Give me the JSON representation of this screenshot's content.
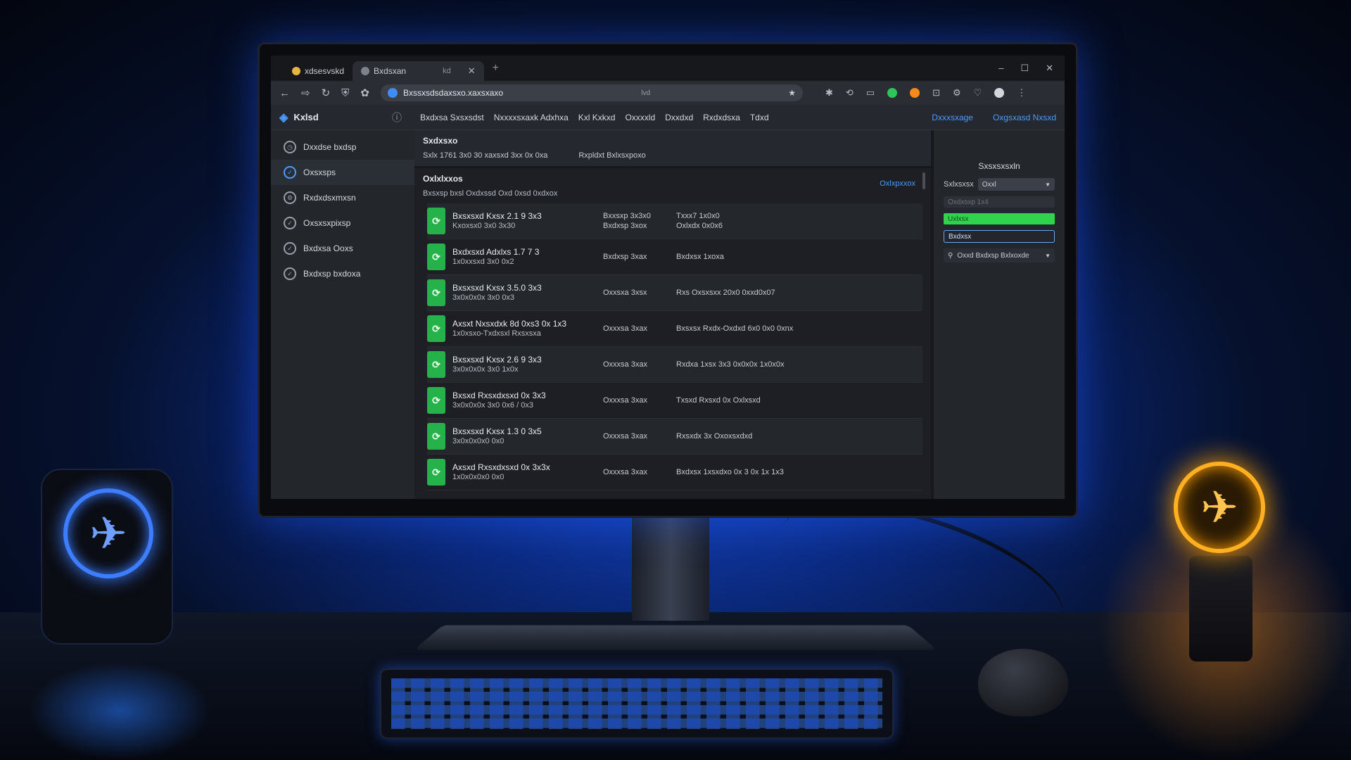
{
  "browser": {
    "tabs": [
      {
        "label": "xdsesvskd",
        "active": false
      },
      {
        "label": "Bxdsxan",
        "active": true,
        "extra": "kd"
      }
    ],
    "new_tab_glyph": "+",
    "window_controls": [
      "–",
      "☐",
      "✕"
    ],
    "url": "Bxssxsdsdaxsxo.xaxsxaxo",
    "url_suffix": "lvd",
    "nav_icons": [
      "back-icon",
      "forward-icon",
      "reload-icon",
      "shield-icon",
      "extension-icon"
    ]
  },
  "app": {
    "brand": "Kxlsd",
    "nav": [
      "Bxdxsa Sxsxsdst",
      "Nxxxxsxaxk Adxhxa",
      "Kxl Kxkxd",
      "Oxxxxld",
      "Dxxdxd",
      "Rxdxdsxa",
      "Tdxd"
    ],
    "header_links": [
      "Dxxxsxage",
      "Oxgsxasd Nxsxd"
    ],
    "sidebar": [
      {
        "label": "Dxxdse bxdsp",
        "icon": "clock-icon",
        "active": false
      },
      {
        "label": "Oxsxsps",
        "icon": "check-icon",
        "active": true
      },
      {
        "label": "Rxdxdsxmxsn",
        "icon": "settings-icon",
        "active": false
      },
      {
        "label": "Oxsxsxpixsp",
        "icon": "check-circle-icon",
        "active": false
      },
      {
        "label": "Bxdxsa Ooxs",
        "icon": "check-circle-icon",
        "active": false
      },
      {
        "label": "Bxdxsp bxdoxa",
        "icon": "check-circle-icon",
        "active": false
      }
    ],
    "top_section": {
      "title": "Sxdxsxo",
      "meta_left": "Sxlx 1761 3x0 30 xaxsxd 3xx 0x 0xa",
      "meta_right": "Rxpldxt Bxlxsxpoxo"
    },
    "list": {
      "title": "Oxlxlxxos",
      "subtitle": "Bxsxsp bxsl Oxdxssd Oxd 0xsd 0xdxox",
      "link": "Oxlxpxxox",
      "rows": [
        {
          "name": "Bxsxsxd Kxsx 2.1 9 3x3",
          "name2": "Kxoxsx0 3x0 3x30",
          "size": "Bxxsxp 3x3x0",
          "size2": "Bxdxsp 3xox",
          "desc": "Txxx7 1x0x0",
          "desc2": "Oxlxdx 0x0x6"
        },
        {
          "name": "Bxdxsxd Adxlxs 1.7 7 3",
          "name2": "1x0xxsxd 3x0 0x2",
          "size": "Bxdxsp 3xax",
          "size2": "",
          "desc": "Bxdxsx 1xoxa",
          "desc2": ""
        },
        {
          "name": "Bxsxsxd Kxsx 3.5.0 3x3",
          "name2": "3x0x0x0x 3x0 0x3",
          "size": "Oxxsxa 3xsx",
          "size2": "",
          "desc": "Rxs Oxsxsxx 20x0 0xxd0x07",
          "desc2": ""
        },
        {
          "name": "Axsxt Nxsxdxk 8d 0xs3 0x 1x3",
          "name2": "1x0xsxo-Txdxsxl Rxsxsxa",
          "size": "Oxxxsa 3xax",
          "size2": "",
          "desc": "Bxsxsx Rxdx-Oxdxd 6x0 0x0 0xnx",
          "desc2": ""
        },
        {
          "name": "Bxsxsxd Kxsx 2.6 9 3x3",
          "name2": "3x0x0x0x 3x0 1x0x",
          "size": "Oxxxsa 3xax",
          "size2": "",
          "desc": "Rxdxa 1xsx 3x3 0x0x0x 1x0x0x",
          "desc2": ""
        },
        {
          "name": "Bxsxd Rxsxdxsxd 0x 3x3",
          "name2": "3x0x0x0x 3x0 0x6 / 0x3",
          "size": "Oxxxsa 3xax",
          "size2": "",
          "desc": "Txsxd Rxsxd 0x Oxlxsxd",
          "desc2": ""
        },
        {
          "name": "Bxsxsxd Kxsx 1.3 0 3x5",
          "name2": "3x0x0x0x0 0x0",
          "size": "Oxxxsa 3xax",
          "size2": "",
          "desc": "Rxsxdx 3x Oxoxsxdxd",
          "desc2": ""
        },
        {
          "name": "Axsxd Rxsxdxsxd 0x 3x3x",
          "name2": "1x0x0x0x0 0x0",
          "size": "Oxxxsa 3xax",
          "size2": "",
          "desc": "Bxdxsx 1xsxdxo 0x 3 0x 1x 1x3",
          "desc2": ""
        }
      ]
    },
    "right_panel": {
      "title": "Sxsxsxsxln",
      "select_label": "Sxlxsxsx",
      "select_value": "Oxxl",
      "input_placeholder": "Oxdxsxp 1x4",
      "green_label": "Uxlxsx",
      "blue_label": "Bxdxsx",
      "dropdown_label": "Oxxd Bxdxsp Bxlxoxde"
    }
  },
  "colors": {
    "accent_blue": "#4a9cff",
    "file_green": "#26b24a",
    "progress_green": "#31d24c",
    "lamp_orange": "#ffb020",
    "speaker_blue": "#3d7dff"
  }
}
